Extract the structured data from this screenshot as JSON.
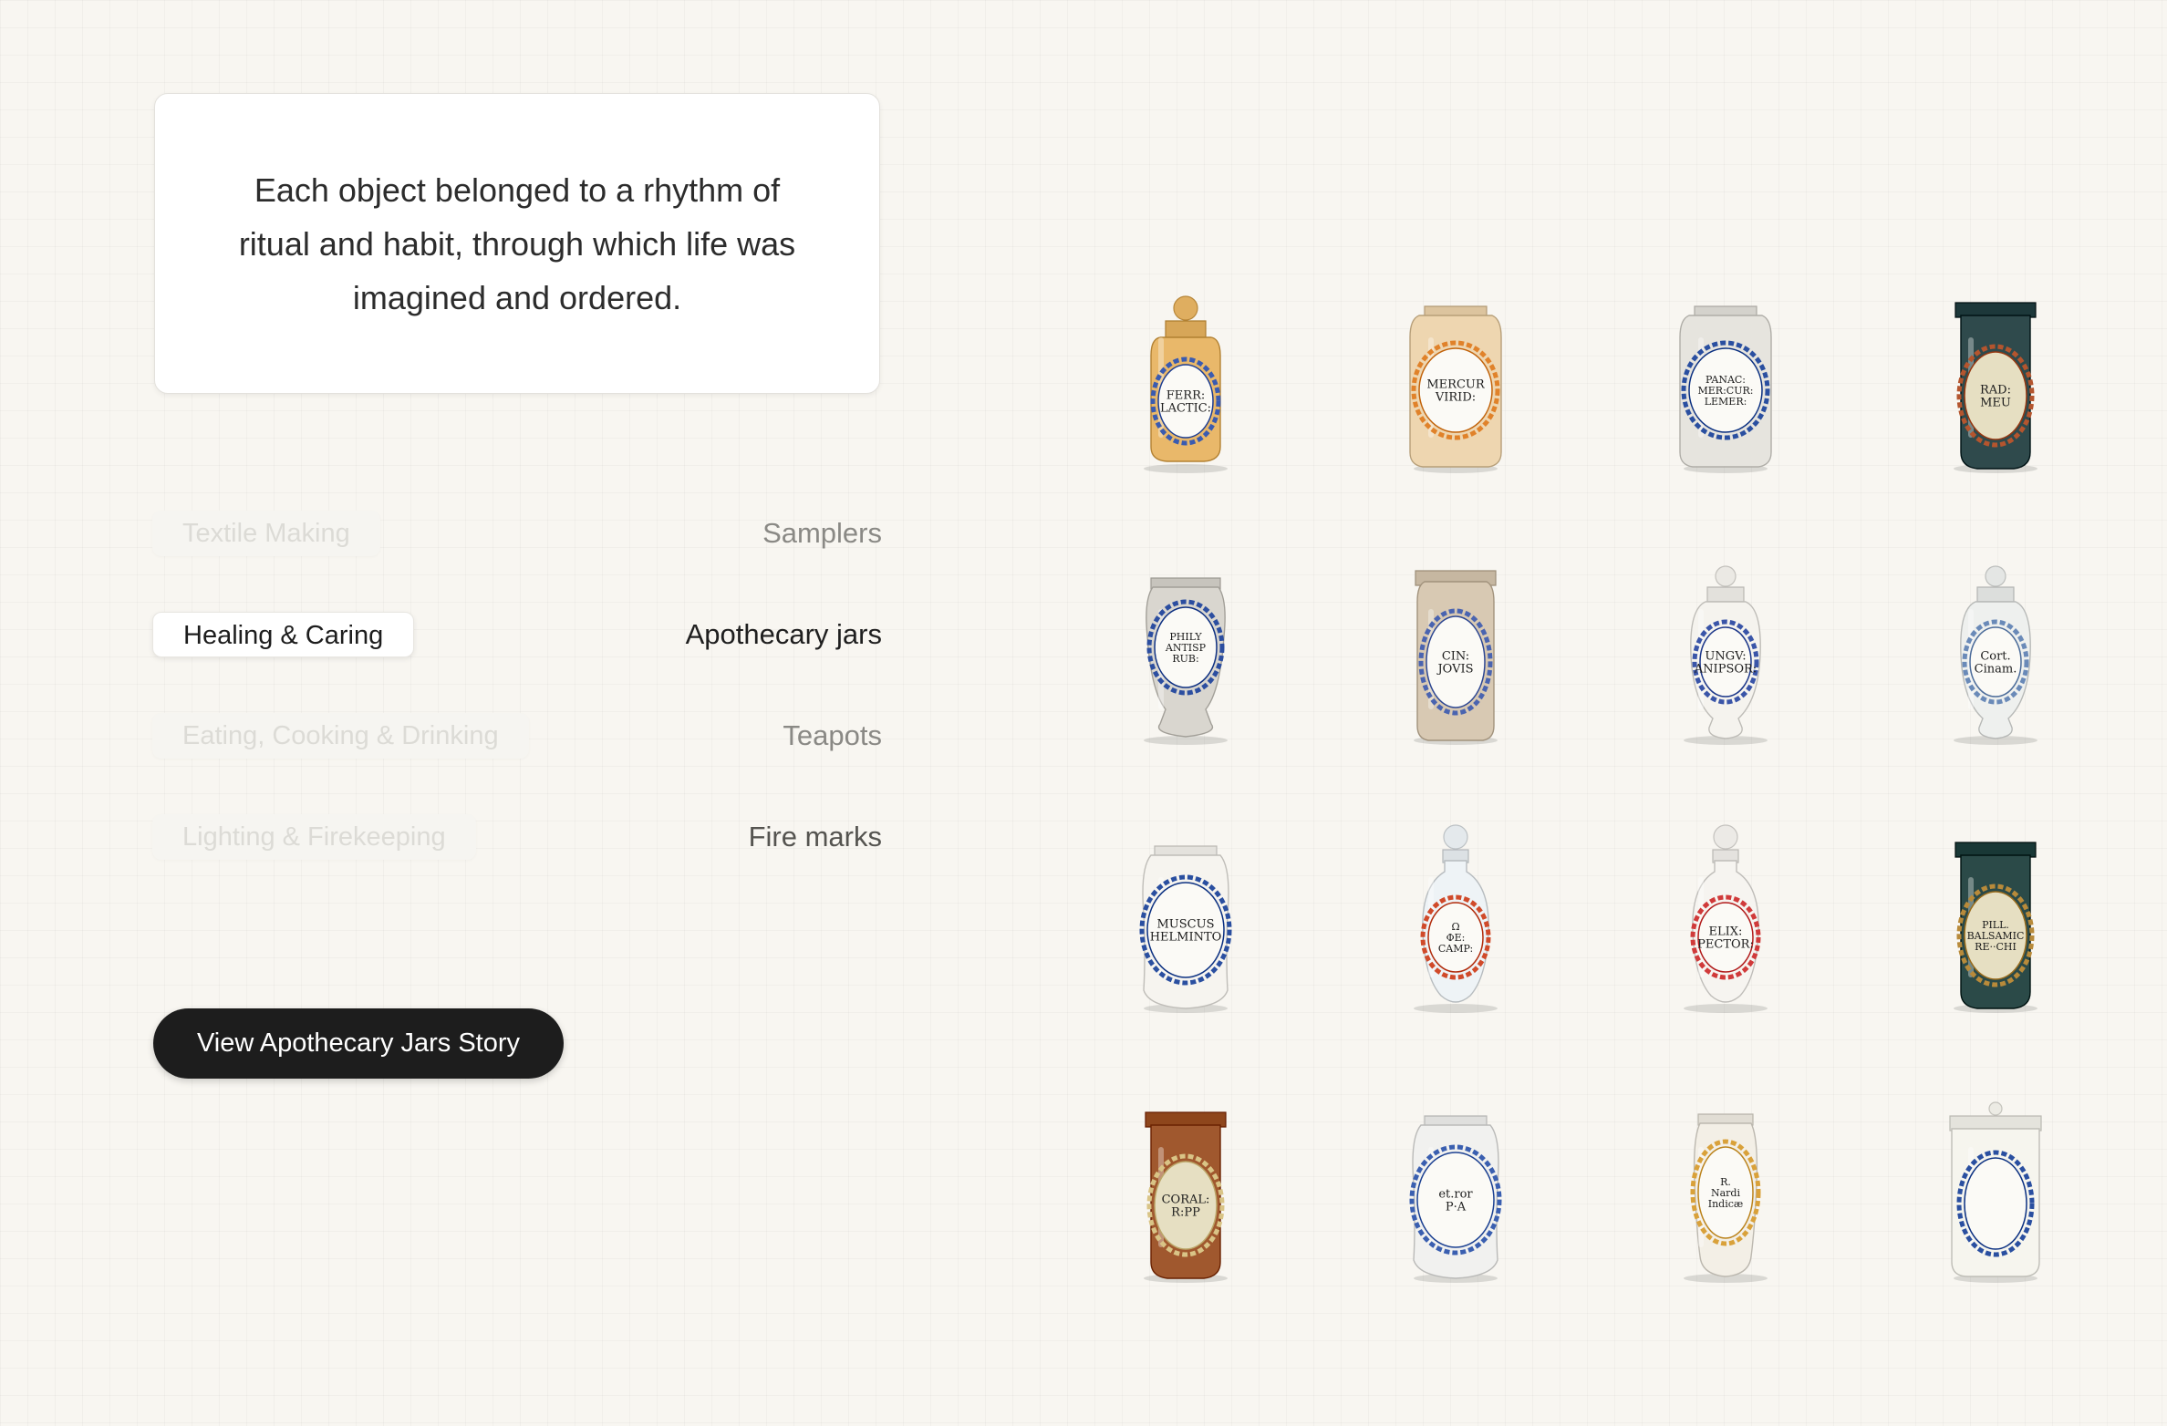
{
  "quote": {
    "text": "Each object belonged to a rhythm of ritual and habit, through which life was imagined and ordered."
  },
  "categories": [
    {
      "label": "Textile Making",
      "object": "Samplers",
      "state": "inactive"
    },
    {
      "label": "Healing & Caring",
      "object": "Apothecary jars",
      "state": "active"
    },
    {
      "label": "Eating, Cooking & Drinking",
      "object": "Teapots",
      "state": "inactive"
    },
    {
      "label": "Lighting & Firekeeping",
      "object": "Fire marks",
      "state": "inactive"
    }
  ],
  "story_button": {
    "label": "View Apothecary Jars Story"
  },
  "jars": [
    {
      "label_lines": [
        "FERR:",
        "LACTIC:"
      ],
      "shape": "lidded-amber",
      "glaze": "#e9b86a",
      "accent": "#3a5bb0"
    },
    {
      "label_lines": [
        "MERCUR",
        "VIRID:"
      ],
      "shape": "square-glass",
      "glaze": "#eed6b0",
      "accent": "#e0822a"
    },
    {
      "label_lines": [
        "PANAC:",
        "MER:CUR:",
        "LEMER:"
      ],
      "shape": "square-glass",
      "glaze": "#e6e4de",
      "accent": "#2a4fa0"
    },
    {
      "label_lines": [
        "RAD:",
        "MEU"
      ],
      "shape": "cylinder-dark",
      "glaze": "#2f4a4c",
      "accent": "#b4552e"
    },
    {
      "label_lines": [
        "PHILY",
        "ANTISP",
        "RUB:"
      ],
      "shape": "pedestal-glass",
      "glaze": "#d9d6cf",
      "accent": "#2c4ea0"
    },
    {
      "label_lines": [
        "CIN:",
        "JOVIS"
      ],
      "shape": "square-tall",
      "glaze": "#d8c9b3",
      "accent": "#4a64b0"
    },
    {
      "label_lines": [
        "UNGV:",
        "ANIPSOR:"
      ],
      "shape": "lidded-white",
      "glaze": "#f5f3ee",
      "accent": "#3a55a8"
    },
    {
      "label_lines": [
        "Cort.",
        "Cinam."
      ],
      "shape": "lidded-white",
      "glaze": "#eef0ee",
      "accent": "#6a8ab8"
    },
    {
      "label_lines": [
        "MUSCUS",
        "HELMINTO"
      ],
      "shape": "albarello-white",
      "glaze": "#f6f4ef",
      "accent": "#2a4fa0"
    },
    {
      "label_lines": [
        "Ω",
        "ΦE:",
        "CAMP:"
      ],
      "shape": "bottle-white",
      "glaze": "#eef3f6",
      "accent": "#d04a2a"
    },
    {
      "label_lines": [
        "ELIX:",
        "PECTOR:"
      ],
      "shape": "bottle-white",
      "glaze": "#f6f4f0",
      "accent": "#d03a3a"
    },
    {
      "label_lines": [
        "PILL.",
        "BALSAMIC",
        "RE··CHI"
      ],
      "shape": "cylinder-dark",
      "glaze": "#2b4a48",
      "accent": "#b88a3a"
    },
    {
      "label_lines": [
        "CORAL:",
        "R:PP"
      ],
      "shape": "cylinder-brown",
      "glaze": "#a0582e",
      "accent": "#d9c486"
    },
    {
      "label_lines": [
        "et.ror",
        "P·A"
      ],
      "shape": "albarello-blue",
      "glaze": "#f1f1ef",
      "accent": "#3a5fb0"
    },
    {
      "label_lines": [
        "R.",
        "Nardi",
        "Indicæ"
      ],
      "shape": "albarello-slim",
      "glaze": "#f3efe6",
      "accent": "#d9a13a"
    },
    {
      "label_lines": [
        ""
      ],
      "shape": "lidded-cylinder-blue",
      "glaze": "#f6f5ee",
      "accent": "#2a4fa0"
    }
  ]
}
